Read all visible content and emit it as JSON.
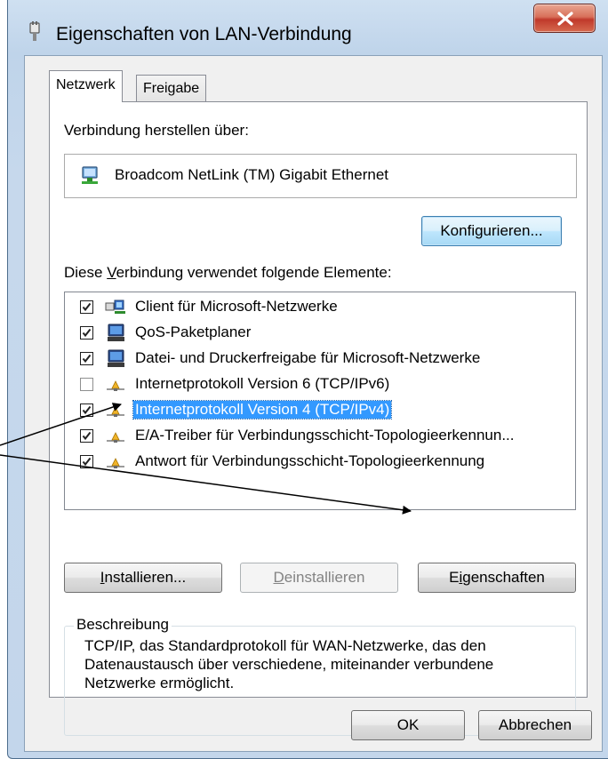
{
  "window": {
    "title": "Eigenschaften von LAN-Verbindung",
    "close_symbol": "X"
  },
  "tabs": [
    {
      "label": "Netzwerk",
      "active": true
    },
    {
      "label": "Freigabe",
      "active": false
    }
  ],
  "connect_using": {
    "label": "Verbindung herstellen über:",
    "adapter_name": "Broadcom NetLink (TM) Gigabit Ethernet",
    "configure_button": "Konfigurieren..."
  },
  "elements": {
    "label_pre": "Diese ",
    "label_accel": "V",
    "label_post": "erbindung verwendet folgende Elemente:",
    "items": [
      {
        "label": "Client für Microsoft-Netzwerke",
        "checked": true,
        "icon": "network-client-icon"
      },
      {
        "label": "QoS-Paketplaner",
        "checked": true,
        "icon": "computer-icon"
      },
      {
        "label": "Datei- und Druckerfreigabe für Microsoft-Netzwerke",
        "checked": true,
        "icon": "computer-icon"
      },
      {
        "label": "Internetprotokoll Version 6 (TCP/IPv6)",
        "checked": false,
        "icon": "protocol-icon"
      },
      {
        "label": "Internetprotokoll Version 4 (TCP/IPv4)",
        "checked": true,
        "icon": "protocol-icon",
        "selected": true
      },
      {
        "label": "E/A-Treiber für Verbindungsschicht-Topologieerkennun...",
        "checked": true,
        "icon": "protocol-icon"
      },
      {
        "label": "Antwort für Verbindungsschicht-Topologieerkennung",
        "checked": true,
        "icon": "protocol-icon"
      }
    ]
  },
  "buttons": {
    "install_accel": "I",
    "install_rest": "nstallieren...",
    "uninstall_accel": "D",
    "uninstall_rest": "einstallieren",
    "properties_pre": "E",
    "properties_accel": "i",
    "properties_rest": "genschaften",
    "ok": "OK",
    "cancel": "Abbrechen"
  },
  "description": {
    "title": "Beschreibung",
    "text": "TCP/IP, das Standardprotokoll für WAN-Netzwerke, das den Datenaustausch über verschiedene, miteinander verbundene Netzwerke ermöglicht."
  },
  "colors": {
    "selection": "#3399ff",
    "close_button": "#c0392b",
    "focus_border": "#3c7fb1"
  }
}
